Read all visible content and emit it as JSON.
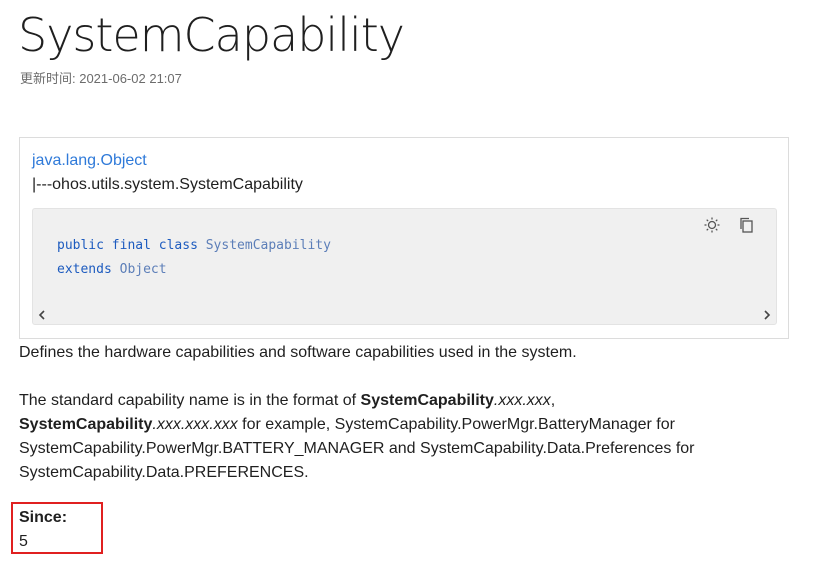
{
  "page": {
    "title": "SystemCapability",
    "updated": "更新时间: 2021-06-02 21:07"
  },
  "hierarchy": {
    "parent_link": "java.lang.Object",
    "child": "|---ohos.utils.system.SystemCapability"
  },
  "code": {
    "line1": {
      "kw1": "public",
      "kw2": "final",
      "kw3": "class",
      "name": "SystemCapability"
    },
    "line2": {
      "kw": "extends",
      "type": "Object"
    },
    "tools": [
      "theme-toggle-icon",
      "copy-icon"
    ]
  },
  "description": {
    "p1": "Defines the hardware capabilities and software capabilities used in the system.",
    "p2": {
      "a": "The standard capability name is in the format of ",
      "b": "SystemCapability",
      "c": ".xxx.xxx",
      "d": ",",
      "e": "SystemCapability",
      "f": ".xxx.xxx.xxx",
      "g": " for example, SystemCapability.PowerMgr.BatteryManager for SystemCapability.PowerMgr.BATTERY_MANAGER and SystemCapability.Data.Preferences for SystemCapability.Data.PREFERENCES."
    }
  },
  "since": {
    "label": "Since:",
    "value": "5"
  },
  "colors": {
    "link": "#2f7ad9",
    "highlight_border": "#e02020",
    "code_bg": "#f0f0f0"
  }
}
